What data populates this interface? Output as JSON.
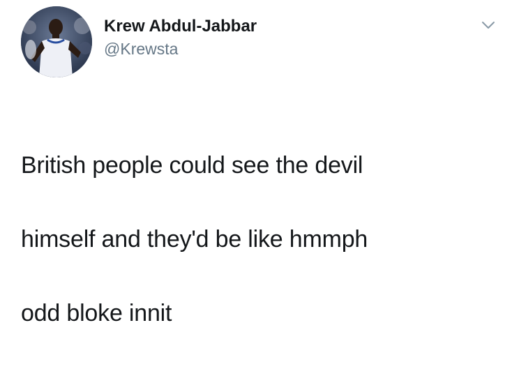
{
  "tweet": {
    "author": {
      "display_name": "Krew Abdul-Jabbar",
      "handle": "@Krewsta",
      "avatar_icon": "profile-photo-basketball-player"
    },
    "menu_icon": "chevron-down-icon",
    "text_lines": [
      "British people could see the devil",
      "himself and they'd be like hmmph",
      "odd bloke innit"
    ]
  },
  "colors": {
    "background": "#ffffff",
    "text_primary": "#14171a",
    "text_secondary": "#657786",
    "chevron": "#8899a6"
  }
}
